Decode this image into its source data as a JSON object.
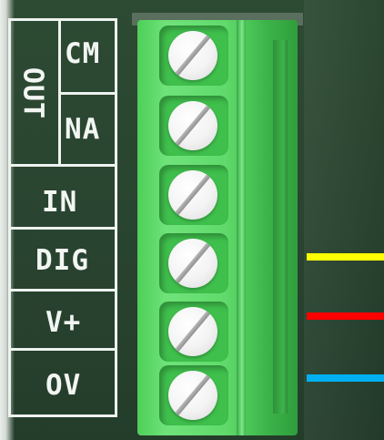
{
  "labels": {
    "out": "OUT",
    "cm": "CM",
    "na": "NA",
    "in": "IN",
    "dig": "DIG",
    "vplus": "V+",
    "ov": "OV"
  },
  "terminal": {
    "screw_count": 6,
    "color": "#5fd96a"
  },
  "wires": [
    {
      "name": "yellow",
      "color": "#ffff00"
    },
    {
      "name": "red",
      "color": "#ff0000"
    },
    {
      "name": "blue",
      "color": "#00b0f0"
    }
  ]
}
